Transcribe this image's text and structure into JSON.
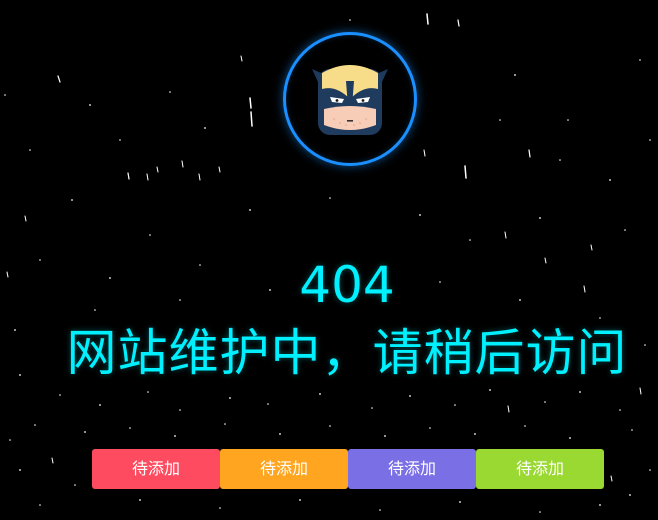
{
  "error": {
    "code": "404",
    "message": "网站维护中，请稍后访问"
  },
  "avatar": {
    "icon": "wolverine-mask-icon",
    "ring_color": "#1a8fff"
  },
  "text_color": "#00f0ff",
  "buttons": [
    {
      "label": "待添加",
      "color": "#ff4b5f"
    },
    {
      "label": "待添加",
      "color": "#ffa51f"
    },
    {
      "label": "待添加",
      "color": "#7b6fe6"
    },
    {
      "label": "待添加",
      "color": "#9ad832"
    }
  ]
}
